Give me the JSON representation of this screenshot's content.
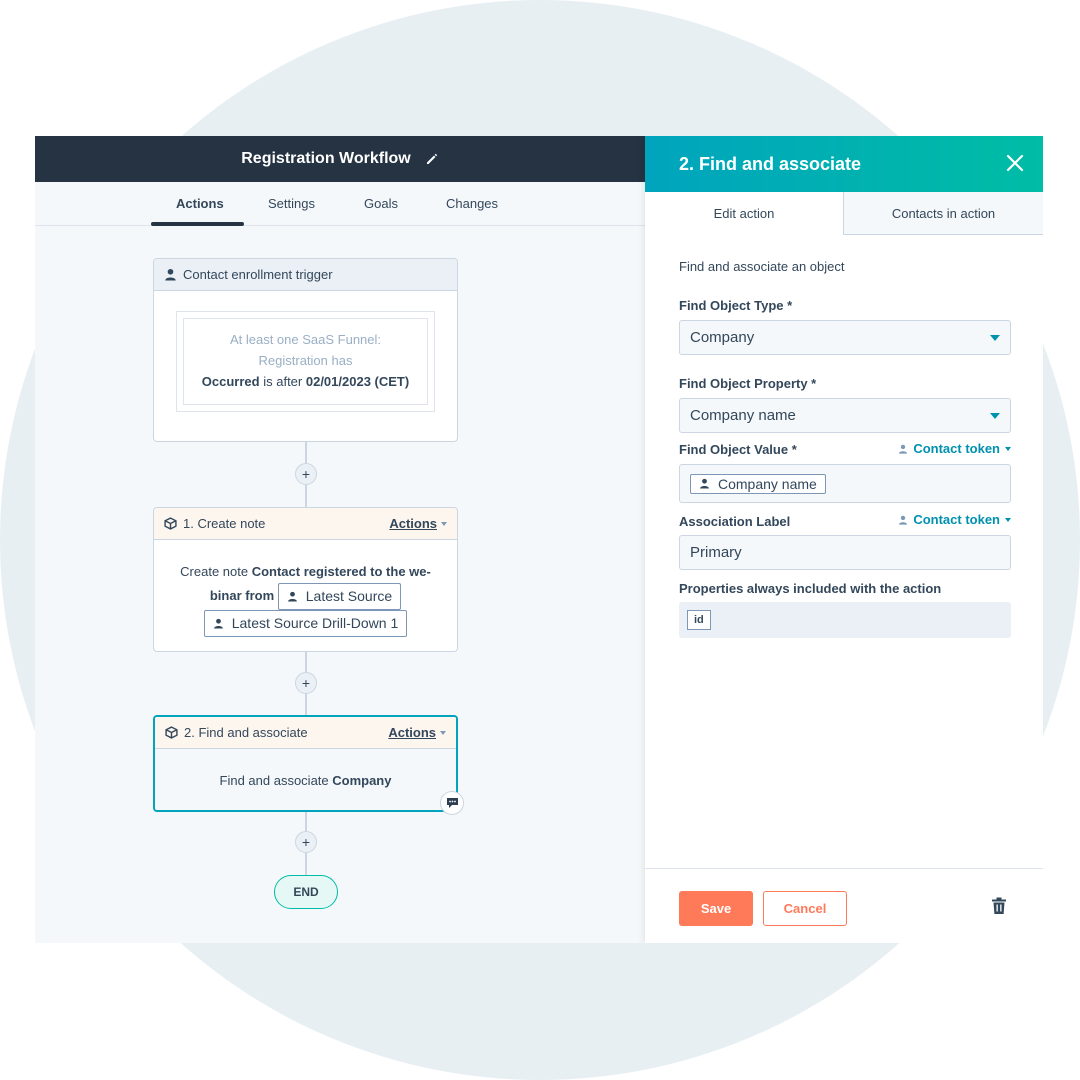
{
  "workflow": {
    "title": "Registration Workflow",
    "tabs": [
      "Actions",
      "Settings",
      "Goals",
      "Changes"
    ],
    "active_tab": "Actions"
  },
  "trigger": {
    "header": "Contact enrollment trigger",
    "line1": "At least one SaaS Funnel: Registration has",
    "occurred": "Occurred",
    "is_after": " is after ",
    "date": "02/01/2023 (CET)"
  },
  "create_note": {
    "header": "1. Create note",
    "actions_label": "Actions",
    "prefix": "Create note ",
    "bold_text": "Contact registered to the we-binar from",
    "token1": "Latest Source",
    "token2": "Latest Source Drill-Down 1"
  },
  "find_associate": {
    "header": "2. Find and associate",
    "actions_label": "Actions",
    "prefix": "Find and associate ",
    "object": "Company"
  },
  "plus_symbol": "+",
  "end_label": "END",
  "panel": {
    "title": "2. Find and associate",
    "tabs": [
      "Edit action",
      "Contacts in action"
    ],
    "intro": "Find and associate an object",
    "object_type_label": "Find Object Type *",
    "object_type_value": "Company",
    "object_property_label": "Find Object Property *",
    "object_property_value": "Company name",
    "object_value_label": "Find Object Value *",
    "contact_token_label": "Contact token",
    "object_value_token": "Company name",
    "association_label": "Association Label",
    "association_value": "Primary",
    "properties_label": "Properties always included with the action",
    "property_chip": "id",
    "save_label": "Save",
    "cancel_label": "Cancel"
  },
  "colors": {
    "header_dark": "#253342",
    "accent_teal": "#00a4bd",
    "accent_orange": "#ff7a59",
    "link_blue": "#0091ae"
  }
}
